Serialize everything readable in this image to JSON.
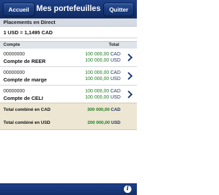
{
  "navbar": {
    "back_label": "Accueil",
    "title": "Mes portefeuilles",
    "quit_label": "Quitter"
  },
  "section": {
    "title": "Placements en Direct",
    "exchange_rate": "1 USD = 1,1495 CAD"
  },
  "table": {
    "col_account": "Compte",
    "col_total": "Total",
    "accounts": [
      {
        "number": "00000000",
        "name": "Compte de REER",
        "cad": "100 000,00",
        "cad_cur": "CAD",
        "usd": "100 000,00",
        "usd_cur": "USD"
      },
      {
        "number": "00000000",
        "name": "Compte de marge",
        "cad": "100 000,00",
        "cad_cur": "CAD",
        "usd": "100 000,00",
        "usd_cur": "USD"
      },
      {
        "number": "00000000",
        "name": "Compte de CELI",
        "cad": "100 000,00",
        "cad_cur": "CAD",
        "usd": "100 000,00",
        "usd_cur": "USD"
      }
    ]
  },
  "totals": {
    "cad_label": "Total combiné en CAD",
    "cad_value": "300 000,00",
    "cad_cur": "CAD",
    "usd_label": "Total combiné en USD",
    "usd_value": "200 000,00",
    "usd_cur": "USD"
  },
  "toolbar": {
    "info_icon": "info-icon",
    "info_glyph": "i"
  },
  "colors": {
    "nav_blue": "#163473",
    "amount_green": "#1d7a1d",
    "totals_bg": "#ece6d3"
  }
}
